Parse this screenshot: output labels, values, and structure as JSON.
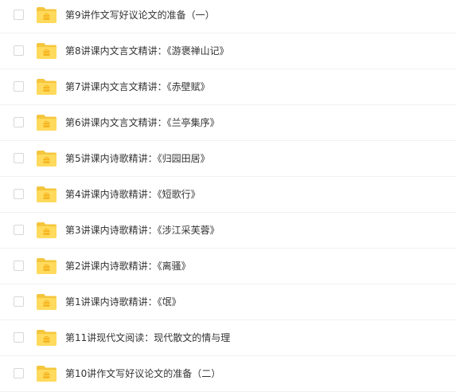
{
  "colors": {
    "folder_back": "#f5c63d",
    "folder_front": "#ffda5c",
    "folder_badge": "#f6b51f",
    "text": "#333333",
    "row_divider": "#f1f1f1",
    "checkbox_border": "#d7d7d7"
  },
  "files": [
    {
      "name": "第9讲作文写好议论文的准备（一）",
      "icon": "folder-icon",
      "checked": false
    },
    {
      "name": "第8讲课内文言文精讲：《游褒禅山记》",
      "icon": "folder-icon",
      "checked": false
    },
    {
      "name": "第7讲课内文言文精讲：《赤壁赋》",
      "icon": "folder-icon",
      "checked": false
    },
    {
      "name": "第6讲课内文言文精讲：《兰亭集序》",
      "icon": "folder-icon",
      "checked": false
    },
    {
      "name": "第5讲课内诗歌精讲：《归园田居》",
      "icon": "folder-icon",
      "checked": false
    },
    {
      "name": "第4讲课内诗歌精讲：《短歌行》",
      "icon": "folder-icon",
      "checked": false
    },
    {
      "name": "第3讲课内诗歌精讲：《涉江采芙蓉》",
      "icon": "folder-icon",
      "checked": false
    },
    {
      "name": "第2讲课内诗歌精讲：《离骚》",
      "icon": "folder-icon",
      "checked": false
    },
    {
      "name": "第1讲课内诗歌精讲：《氓》",
      "icon": "folder-icon",
      "checked": false
    },
    {
      "name": "第11讲现代文阅读：现代散文的情与理",
      "icon": "folder-icon",
      "checked": false
    },
    {
      "name": "第10讲作文写好议论文的准备（二）",
      "icon": "folder-icon",
      "checked": false
    }
  ]
}
